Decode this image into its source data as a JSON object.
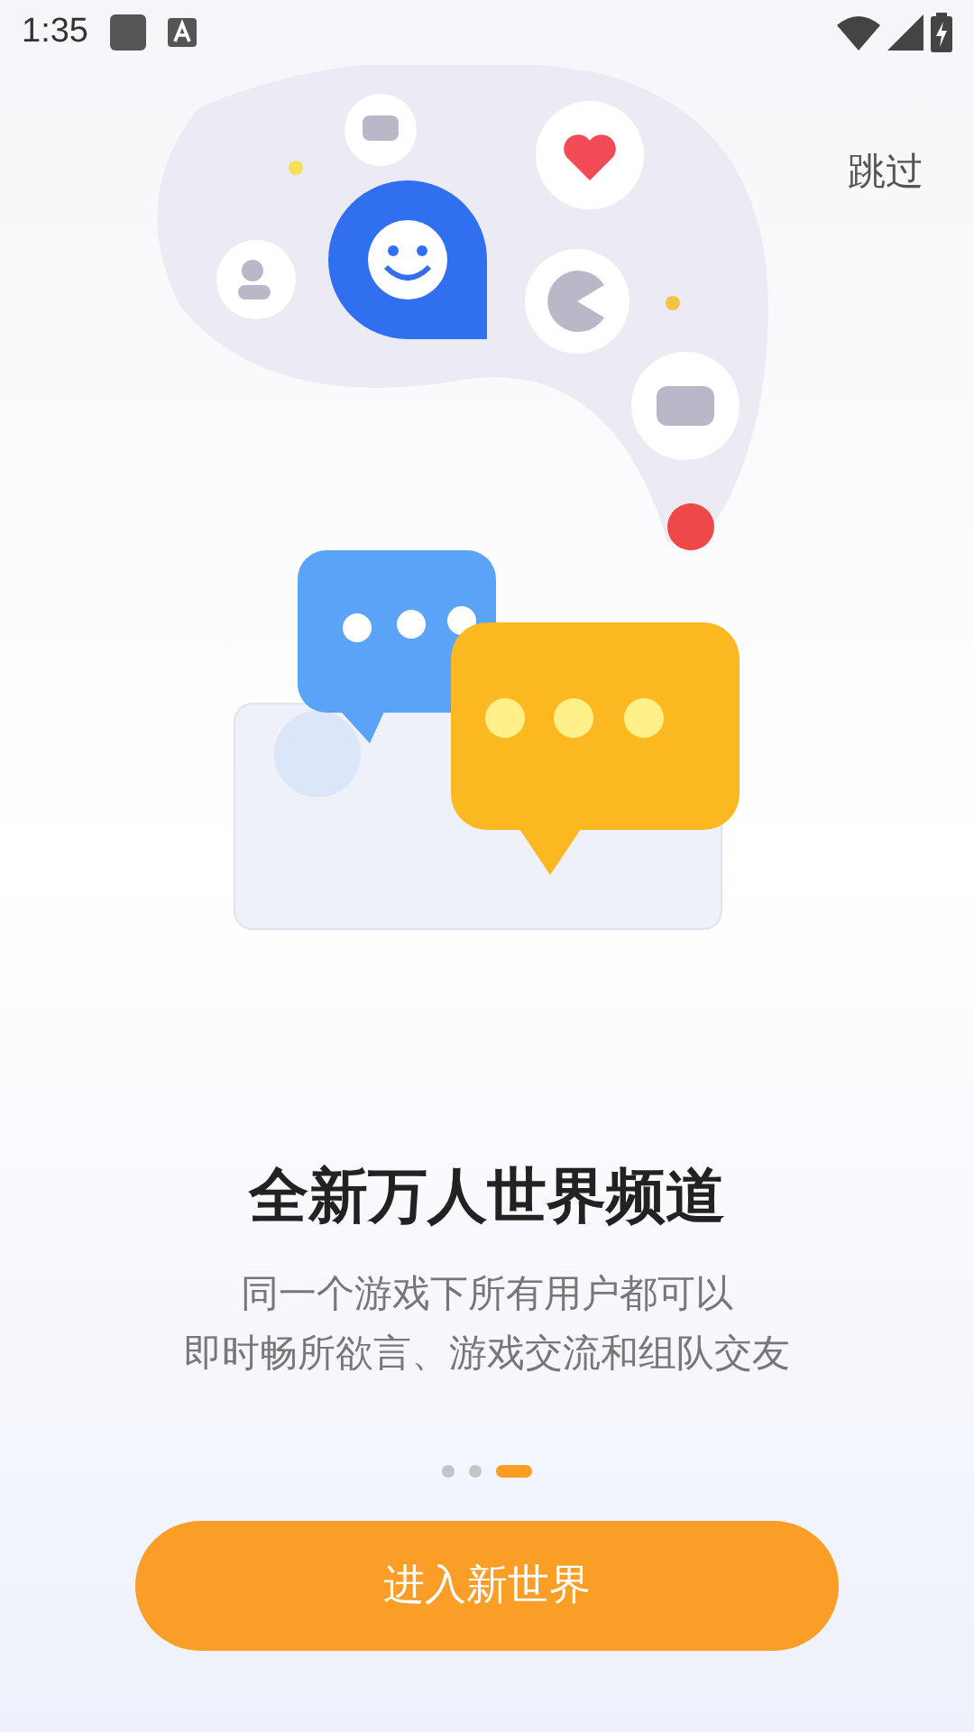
{
  "status_bar": {
    "time": "1:35"
  },
  "skip": "跳过",
  "title": "全新万人世界频道",
  "subtitle_lines": [
    "同一个游戏下所有用户都可以",
    "即时畅所欲言、游戏交流和组队交友"
  ],
  "pager": [
    {
      "selected": false
    },
    {
      "selected": false
    },
    {
      "selected": true
    }
  ],
  "enter_button": "进入新世界"
}
